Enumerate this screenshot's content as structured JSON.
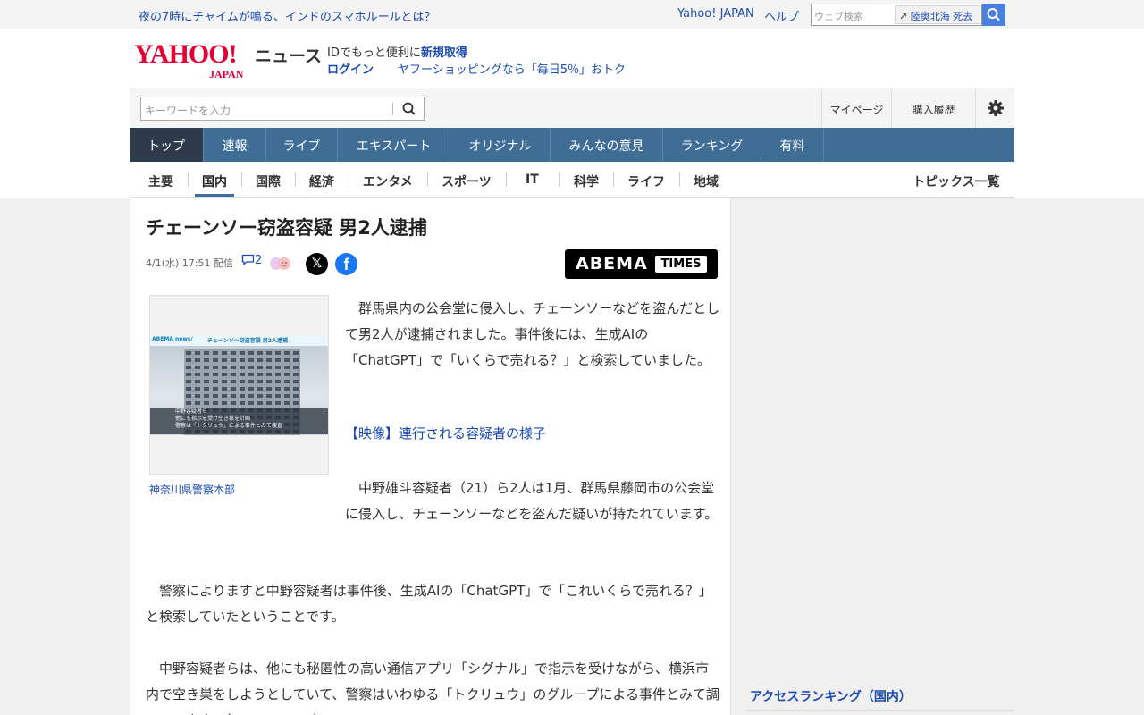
{
  "topbar": {
    "promo": "夜の7時にチャイムが鳴る、インドのスマホルールとは？",
    "yahoo_japan": "Yahoo! JAPAN",
    "help": "ヘルプ",
    "web_search_placeholder": "ウェブ検索",
    "trend_word": "陸奥北海 死去"
  },
  "header": {
    "logo_text": "YAHOO!",
    "logo_sub": "JAPAN",
    "section": "ニュース",
    "id_prefix": "IDでもっと便利に",
    "id_link": "新規取得",
    "login": "ログイン",
    "shopping": "ヤフーショッピングなら「毎日5％」おトク"
  },
  "search": {
    "placeholder": "キーワードを入力",
    "mypage": "マイページ",
    "history": "購入履歴"
  },
  "catnav": [
    "トップ",
    "速報",
    "ライブ",
    "エキスパート",
    "オリジナル",
    "みんなの意見",
    "ランキング",
    "有料"
  ],
  "subnav": [
    "主要",
    "国内",
    "国際",
    "経済",
    "エンタメ",
    "スポーツ",
    "IT",
    "科学",
    "ライフ",
    "地域"
  ],
  "subnav_right": "トピックス一覧",
  "article": {
    "title": "チェーンソー窃盗容疑 男2人逮捕",
    "date": "4/1(水) 17:51 配信",
    "comment_count": "2",
    "source_logo": "ABEMA",
    "source_logo_badge": "TIMES",
    "photo_banner_logo": "ABEMA news/",
    "photo_banner_title": "チェーンソー窃盗容疑 男2人逮捕",
    "photo_caption_lines": [
      "中野容疑者ら",
      "他にも指示を受け空き巣を計画",
      "警察は「トクリュウ」による事件とみて捜査"
    ],
    "photo_credit": "神奈川県警察本部",
    "p1": "　群馬県内の公会堂に侵入し、チェーンソーなどを盗んだとして男2人が逮捕されました。事件後には、生成AIの「ChatGPT」で「いくらで売れる？」と検索していました。",
    "video_link": "【映像】連行される容疑者の様子",
    "p2": "　中野雄斗容疑者（21）ら2人は1月、群馬県藤岡市の公会堂に侵入し、チェーンソーなどを盗んだ疑いが持たれています。",
    "p3": "　警察によりますと中野容疑者は事件後、生成AIの「ChatGPT」で「これいくらで売れる？」と検索していたということです。",
    "p4": "　中野容疑者らは、他にも秘匿性の高い通信アプリ「シグナル」で指示を受けながら、横浜市内で空き巣をしようとしていて、警察はいわゆる「トクリュウ」のグループによる事件とみて調べています。（ANNニュース）"
  },
  "sidebar": {
    "ranking_title": "アクセスランキング（国内）"
  },
  "colors": {
    "nav_bg": "#3f6d96",
    "nav_active": "#2d3b4c",
    "link": "#1a4bb3",
    "brand_red": "#e60033"
  }
}
